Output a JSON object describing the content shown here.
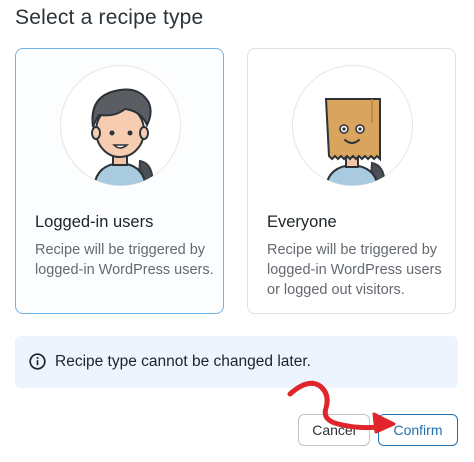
{
  "dialog": {
    "title": "Select a recipe type"
  },
  "options": [
    {
      "title": "Logged-in users",
      "description": "Recipe will be triggered by logged-in WordPress users.",
      "selected": true,
      "icon": "user-avatar-icon"
    },
    {
      "title": "Everyone",
      "description": "Recipe will be triggered by logged-in WordPress users or logged out visitors.",
      "selected": false,
      "icon": "paper-bag-avatar-icon"
    }
  ],
  "notice": {
    "icon": "info-icon",
    "text": "Recipe type cannot be changed later."
  },
  "buttons": {
    "cancel": "Cancel",
    "confirm": "Confirm"
  },
  "colors": {
    "accent": "#2271b1",
    "selected_border": "#6cb4e4",
    "notice_bg": "#edf4fd",
    "annotation_arrow": "#e0262c"
  }
}
